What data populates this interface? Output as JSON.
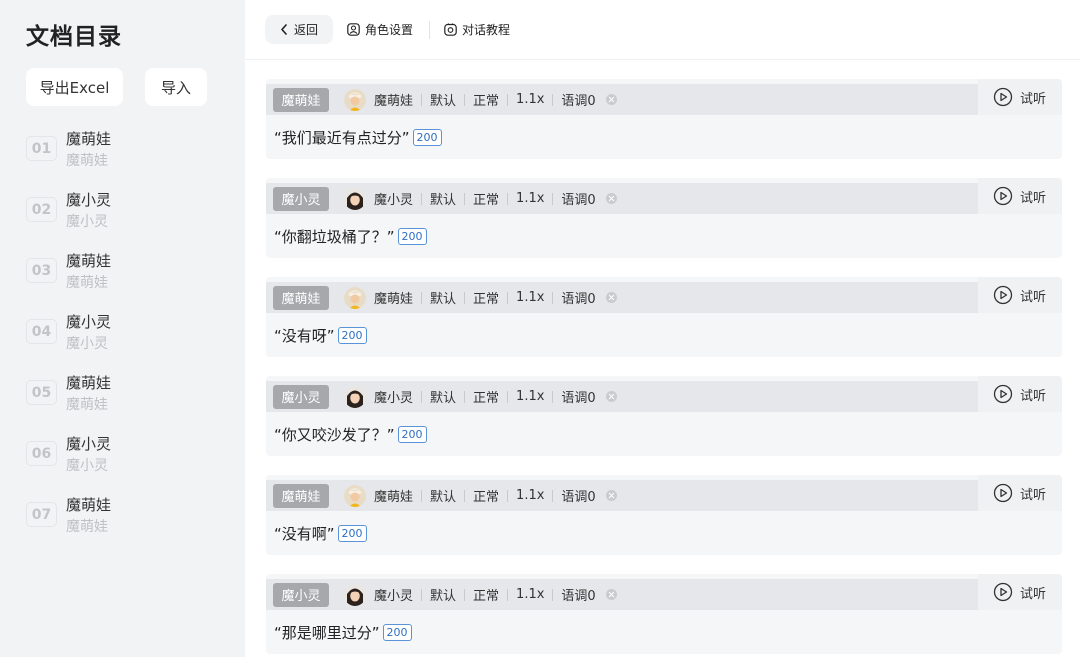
{
  "sidebar": {
    "title": "文档目录",
    "export_label": "导出Excel",
    "import_label": "导入",
    "items": [
      {
        "num": "01",
        "name": "魔萌娃",
        "sub": "魔萌娃"
      },
      {
        "num": "02",
        "name": "魔小灵",
        "sub": "魔小灵"
      },
      {
        "num": "03",
        "name": "魔萌娃",
        "sub": "魔萌娃"
      },
      {
        "num": "04",
        "name": "魔小灵",
        "sub": "魔小灵"
      },
      {
        "num": "05",
        "name": "魔萌娃",
        "sub": "魔萌娃"
      },
      {
        "num": "06",
        "name": "魔小灵",
        "sub": "魔小灵"
      },
      {
        "num": "07",
        "name": "魔萌娃",
        "sub": "魔萌娃"
      }
    ]
  },
  "topbar": {
    "back_label": "返回",
    "role_settings_label": "角色设置",
    "tutorial_label": "对话教程"
  },
  "cards": [
    {
      "tag": "魔萌娃",
      "voice": "魔萌娃",
      "style": "默认",
      "mood": "正常",
      "speed": "1.1x",
      "pitch": "语调0",
      "try_label": "试听",
      "text": "“我们最近有点过分”",
      "count": "200",
      "avatar": "boy"
    },
    {
      "tag": "魔小灵",
      "voice": "魔小灵",
      "style": "默认",
      "mood": "正常",
      "speed": "1.1x",
      "pitch": "语调0",
      "try_label": "试听",
      "text": "“你翻垃圾桶了？”",
      "count": "200",
      "avatar": "girl"
    },
    {
      "tag": "魔萌娃",
      "voice": "魔萌娃",
      "style": "默认",
      "mood": "正常",
      "speed": "1.1x",
      "pitch": "语调0",
      "try_label": "试听",
      "text": "“没有呀”",
      "count": "200",
      "avatar": "boy"
    },
    {
      "tag": "魔小灵",
      "voice": "魔小灵",
      "style": "默认",
      "mood": "正常",
      "speed": "1.1x",
      "pitch": "语调0",
      "try_label": "试听",
      "text": "“你又咬沙发了？”",
      "count": "200",
      "avatar": "girl"
    },
    {
      "tag": "魔萌娃",
      "voice": "魔萌娃",
      "style": "默认",
      "mood": "正常",
      "speed": "1.1x",
      "pitch": "语调0",
      "try_label": "试听",
      "text": "“没有啊”",
      "count": "200",
      "avatar": "boy"
    },
    {
      "tag": "魔小灵",
      "voice": "魔小灵",
      "style": "默认",
      "mood": "正常",
      "speed": "1.1x",
      "pitch": "语调0",
      "try_label": "试听",
      "text": "“那是哪里过分”",
      "count": "200",
      "avatar": "girl"
    }
  ],
  "icons": {
    "back": "chevron-left-icon",
    "role": "user-circle-icon",
    "tutorial": "camera-icon",
    "play": "play-circle-icon",
    "remove": "close-icon"
  },
  "colors": {
    "sidebar_bg": "#f2f3f5",
    "tag_bg": "#a6a8ac",
    "badge_border": "#5b93d8",
    "card_bg": "#f5f6f8"
  }
}
